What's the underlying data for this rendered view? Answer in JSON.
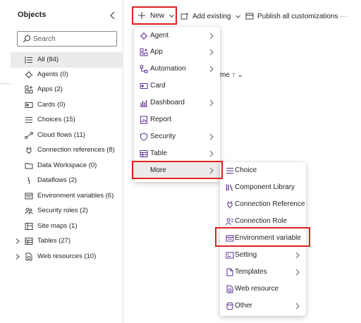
{
  "colors": {
    "highlight_border": "#e02020",
    "icon_accent": "#5c2d91",
    "selected_bg": "#ebebeb"
  },
  "panel": {
    "title": "Objects",
    "search_placeholder": "Search",
    "items": [
      {
        "label": "All  (84)",
        "icon": "list-icon"
      },
      {
        "label": "Agents  (0)",
        "icon": "agent-icon"
      },
      {
        "label": "Apps  (2)",
        "icon": "apps-icon"
      },
      {
        "label": "Cards  (0)",
        "icon": "card-icon"
      },
      {
        "label": "Choices  (15)",
        "icon": "choice-icon"
      },
      {
        "label": "Cloud flows  (11)",
        "icon": "flow-icon"
      },
      {
        "label": "Connection references  (8)",
        "icon": "plug-icon"
      },
      {
        "label": "Data Workspace  (0)",
        "icon": "folder-icon"
      },
      {
        "label": "Dataflows  (2)",
        "icon": "dataflow-icon"
      },
      {
        "label": "Environment variables  (6)",
        "icon": "env-var-icon"
      },
      {
        "label": "Security roles  (2)",
        "icon": "people-icon"
      },
      {
        "label": "Site maps  (1)",
        "icon": "sitemap-icon"
      },
      {
        "label": "Tables  (27)",
        "icon": "table-icon"
      },
      {
        "label": "Web resources  (10)",
        "icon": "web-resource-icon"
      }
    ]
  },
  "commandbar": {
    "new_label": "New",
    "add_existing_label": "Add existing",
    "publish_label": "Publish all customizations",
    "overflow_label": "···"
  },
  "background": {
    "sort_fragment": "me ↑ ⌄"
  },
  "new_menu": {
    "items": [
      {
        "label": "Agent",
        "icon": "agent-icon",
        "submenu": true
      },
      {
        "label": "App",
        "icon": "apps-icon",
        "submenu": true
      },
      {
        "label": "Automation",
        "icon": "automation-icon",
        "submenu": true
      },
      {
        "label": "Card",
        "icon": "card-icon",
        "submenu": false
      },
      {
        "label": "Dashboard",
        "icon": "dashboard-icon",
        "submenu": true
      },
      {
        "label": "Report",
        "icon": "report-icon",
        "submenu": false
      },
      {
        "label": "Security",
        "icon": "shield-icon",
        "submenu": true
      },
      {
        "label": "Table",
        "icon": "table-icon",
        "submenu": true
      },
      {
        "label": "More",
        "icon": "",
        "submenu": true
      }
    ]
  },
  "more_menu": {
    "items": [
      {
        "label": "Choice",
        "icon": "choice-icon",
        "submenu": false
      },
      {
        "label": "Component Library",
        "icon": "library-icon",
        "submenu": false
      },
      {
        "label": "Connection Reference",
        "icon": "plug-icon",
        "submenu": false
      },
      {
        "label": "Connection Role",
        "icon": "connection-role-icon",
        "submenu": false
      },
      {
        "label": "Environment variable",
        "icon": "env-var-icon",
        "submenu": false
      },
      {
        "label": "Setting",
        "icon": "setting-icon",
        "submenu": true
      },
      {
        "label": "Templates",
        "icon": "templates-icon",
        "submenu": true
      },
      {
        "label": "Web resource",
        "icon": "web-resource-icon",
        "submenu": false
      },
      {
        "label": "Other",
        "icon": "database-icon",
        "submenu": true
      }
    ]
  }
}
